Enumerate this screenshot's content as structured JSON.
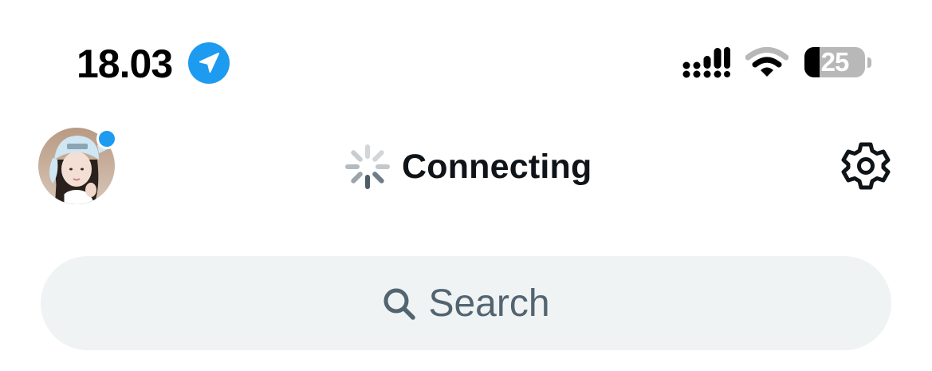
{
  "status_bar": {
    "time": "18.03",
    "location_icon": "location-arrow-icon",
    "signal_icon": "cellular-signal-icon",
    "wifi_icon": "wifi-icon",
    "battery_level": "25",
    "battery_fraction": 0.25
  },
  "header": {
    "avatar_icon": "profile-avatar",
    "title": "Connecting",
    "spinner_icon": "loading-spinner-icon",
    "settings_icon": "gear-icon"
  },
  "search": {
    "placeholder": "Search",
    "icon": "search-icon"
  },
  "colors": {
    "accent": "#1d9bf0",
    "text_primary": "#0f1419",
    "text_secondary": "#536471",
    "search_background": "#eff3f4"
  }
}
